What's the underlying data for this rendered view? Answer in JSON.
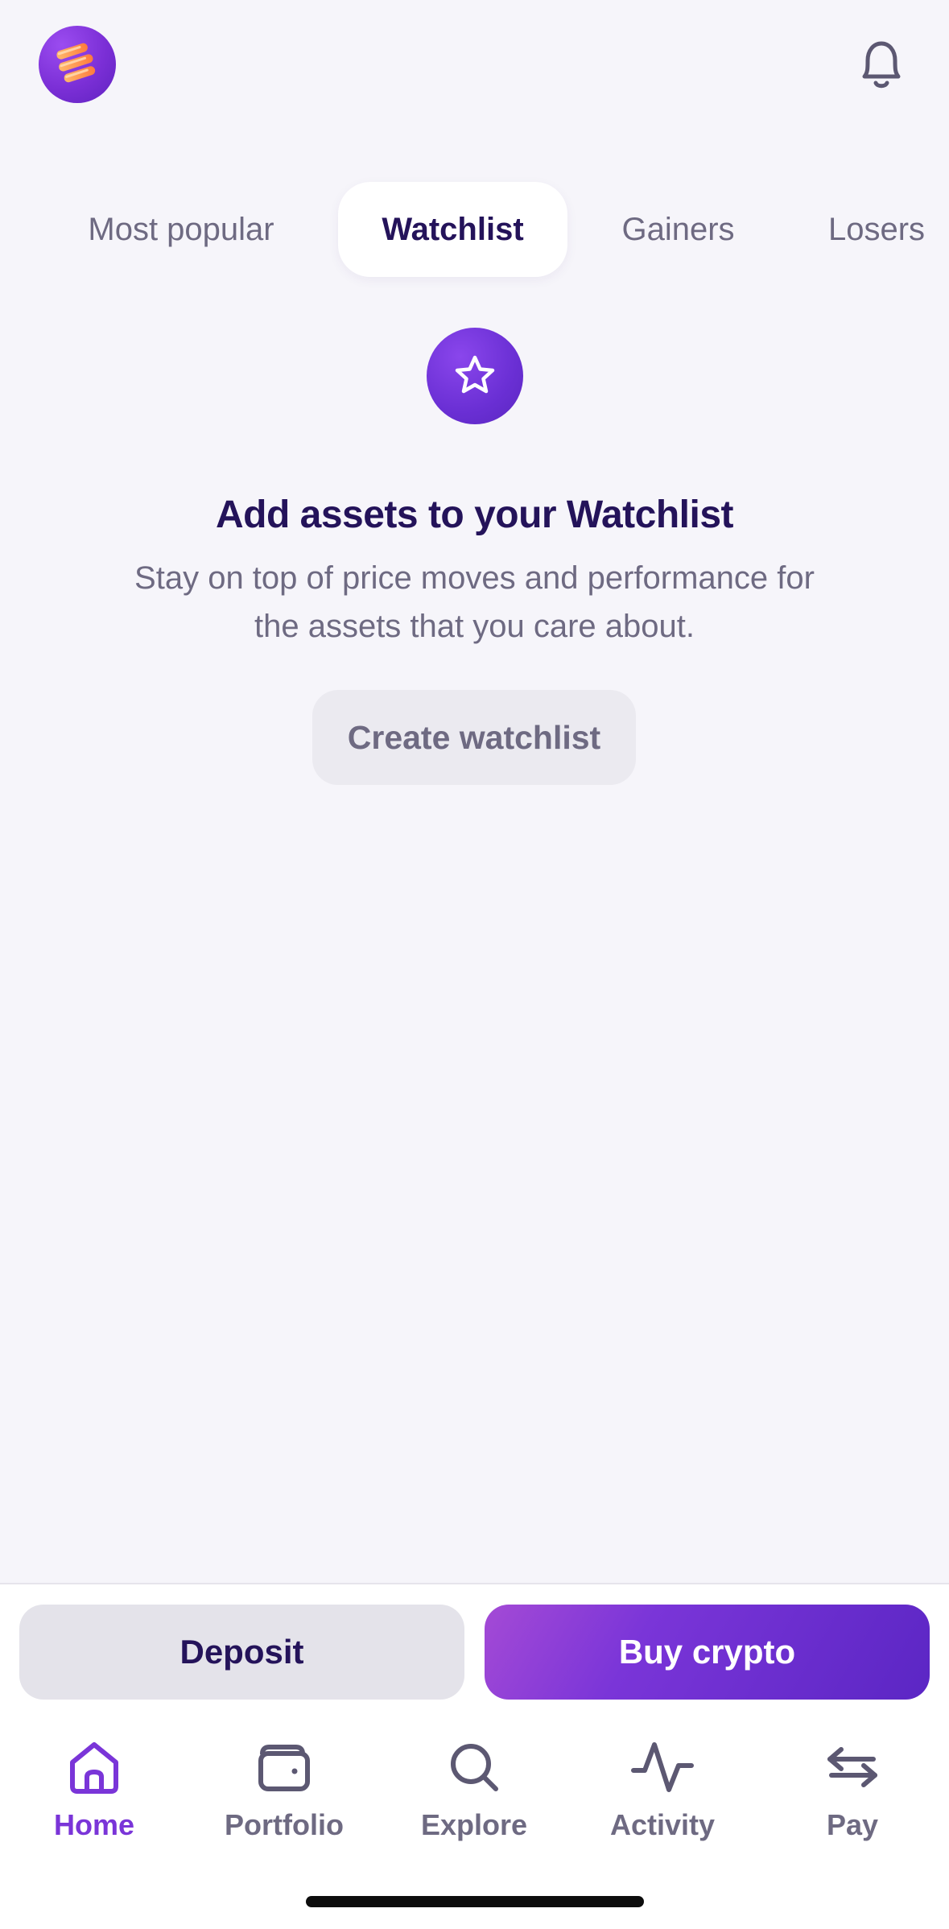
{
  "header": {
    "avatar_icon": "stacked-coins-avatar",
    "bell_icon": "bell-icon"
  },
  "tabs": [
    {
      "label": "Most popular",
      "active": false
    },
    {
      "label": "Watchlist",
      "active": true
    },
    {
      "label": "Gainers",
      "active": false
    },
    {
      "label": "Losers",
      "active": false
    }
  ],
  "empty_state": {
    "icon": "star-icon",
    "title": "Add assets to your Watchlist",
    "description": "Stay on top of price moves and performance for the assets that you care about.",
    "button_label": "Create watchlist"
  },
  "actions": {
    "deposit_label": "Deposit",
    "buy_label": "Buy crypto"
  },
  "nav": [
    {
      "label": "Home",
      "icon": "home-icon",
      "active": true
    },
    {
      "label": "Portfolio",
      "icon": "wallet-icon",
      "active": false
    },
    {
      "label": "Explore",
      "icon": "search-icon",
      "active": false
    },
    {
      "label": "Activity",
      "icon": "activity-icon",
      "active": false
    },
    {
      "label": "Pay",
      "icon": "transfer-arrows-icon",
      "active": false
    }
  ],
  "colors": {
    "background": "#f6f5fa",
    "accent": "#7a35d8",
    "text_primary": "#24135a",
    "text_secondary": "#6e6a82"
  }
}
